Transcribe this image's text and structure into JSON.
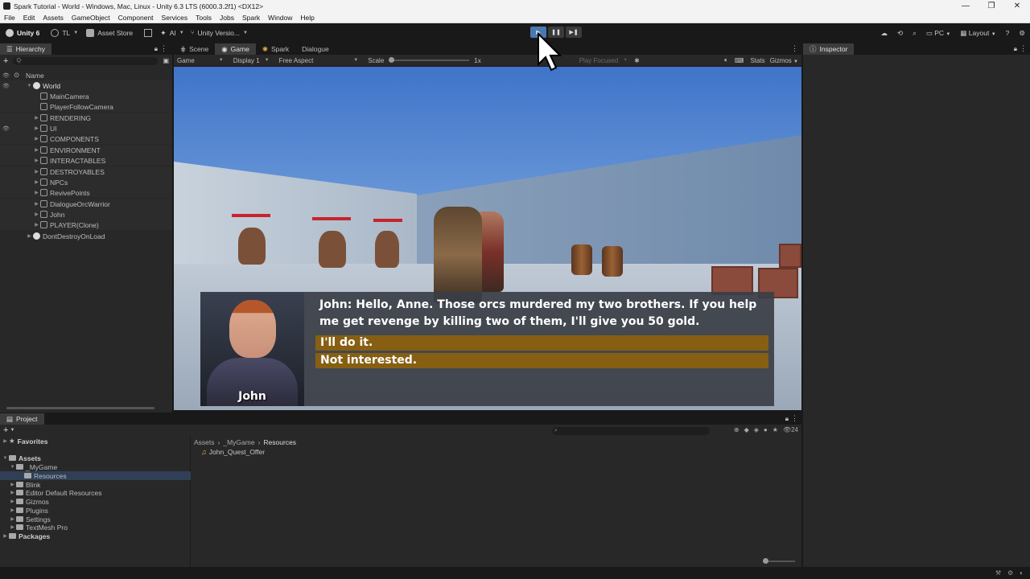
{
  "window": {
    "title": "Spark Tutorial - World - Windows, Mac, Linux - Unity 6.3 LTS (6000.3.2f1) <DX12>",
    "controls": [
      "—",
      "❐",
      "✕"
    ]
  },
  "menu": [
    "File",
    "Edit",
    "Assets",
    "GameObject",
    "Component",
    "Services",
    "Tools",
    "Jobs",
    "Spark",
    "Window",
    "Help"
  ],
  "toolbar": {
    "account": "Unity 6",
    "user": "TL",
    "asset_store": "Asset Store",
    "ai": "AI",
    "version_control": "Unity Versio...",
    "platform": "PC",
    "layout": "Layout"
  },
  "hierarchy": {
    "tab": "Hierarchy",
    "search_placeholder": "Q·",
    "column": "Name",
    "items": [
      {
        "label": "World"
      },
      {
        "label": "MainCamera"
      },
      {
        "label": "PlayerFollowCamera"
      },
      {
        "label": "RENDERING"
      },
      {
        "label": "UI"
      },
      {
        "label": "COMPONENTS"
      },
      {
        "label": "ENVIRONMENT"
      },
      {
        "label": "INTERACTABLES"
      },
      {
        "label": "DESTROYABLES"
      },
      {
        "label": "NPCs"
      },
      {
        "label": "RevivePoints"
      },
      {
        "label": "DialogueOrcWarrior"
      },
      {
        "label": "John"
      },
      {
        "label": "PLAYER(Clone)"
      },
      {
        "label": "DontDestroyOnLoad"
      }
    ]
  },
  "center_tabs": [
    {
      "label": "Scene"
    },
    {
      "label": "Game"
    },
    {
      "label": "Spark"
    },
    {
      "label": "Dialogue"
    }
  ],
  "game_toolbar": {
    "view": "Game",
    "display": "Display 1",
    "aspect": "Free Aspect",
    "scale_label": "Scale",
    "scale_value": "1x",
    "play_focused": "Play Focused",
    "stats": "Stats",
    "gizmos": "Gizmos"
  },
  "dialogue": {
    "speaker": "John",
    "text": "John: Hello, Anne. Those orcs murdered my two brothers. If you help me get revenge by killing two of them, I'll give you 50 gold.",
    "choices": [
      "I'll do it.",
      "Not interested."
    ]
  },
  "inspector": {
    "tab": "Inspector"
  },
  "project": {
    "tab": "Project",
    "favorites": "Favorites",
    "tree": [
      {
        "label": "Assets"
      },
      {
        "label": "_MyGame"
      },
      {
        "label": "Resources"
      },
      {
        "label": "Blink"
      },
      {
        "label": "Editor Default Resources"
      },
      {
        "label": "Gizmos"
      },
      {
        "label": "Plugins"
      },
      {
        "label": "Settings"
      },
      {
        "label": "TextMesh Pro"
      },
      {
        "label": "Packages"
      }
    ],
    "breadcrumb": [
      "Assets",
      "_MyGame",
      "Resources"
    ],
    "asset": "John_Quest_Offer",
    "count": "24"
  },
  "colors": {
    "choice_bg": "#875f12",
    "play_active": "#4a78b0",
    "panel_bg": "#282828"
  }
}
